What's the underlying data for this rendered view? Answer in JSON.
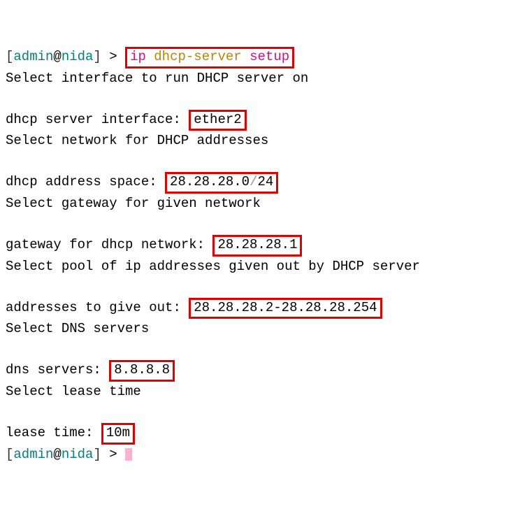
{
  "prompt": {
    "user": "admin",
    "at": "@",
    "host": "nida",
    "open": "[",
    "close": "]",
    "gt": ">"
  },
  "cmd": {
    "ip": "ip",
    "dhcp_server": "dhcp-server",
    "setup": "setup"
  },
  "lines": {
    "l1": "Select interface to run DHCP server on",
    "l2_label": "dhcp server interface: ",
    "l2_value": "ether2",
    "l3": "Select network for DHCP addresses",
    "l4_label": "dhcp address space: ",
    "l4_value_a": "28.28.28.0",
    "l4_value_slash": "/",
    "l4_value_b": "24",
    "l5": "Select gateway for given network",
    "l6_label": "gateway for dhcp network: ",
    "l6_value": "28.28.28.1",
    "l7": "Select pool of ip addresses given out by DHCP server",
    "l8_label": "addresses to give out: ",
    "l8_value": "28.28.28.2-28.28.28.254",
    "l9": "Select DNS servers",
    "l10_label": "dns servers: ",
    "l10_value": "8.8.8.8",
    "l11": "Select lease time",
    "l12_label": "lease time: ",
    "l12_value": "10m"
  }
}
